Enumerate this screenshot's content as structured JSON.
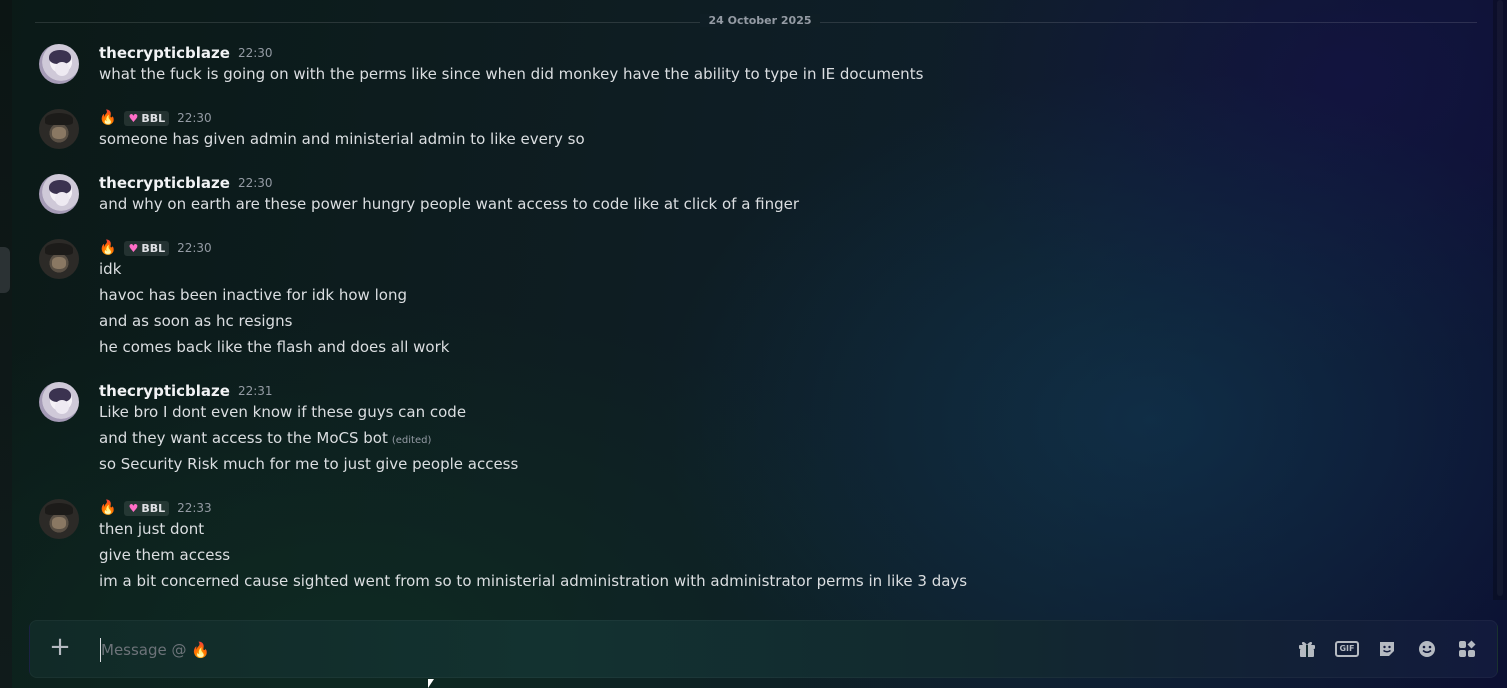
{
  "date_divider": "24 October 2025",
  "messages": [
    {
      "user": "thecrypticblaze",
      "time": "22:30",
      "lines": [
        "what the fuck is going on with the perms like since when did monkey have the ability to type in IE documents"
      ]
    },
    {
      "user": "",
      "tag": "BBL",
      "time": "22:30",
      "lines": [
        "someone has given admin and ministerial admin to like every so"
      ]
    },
    {
      "user": "thecrypticblaze",
      "time": "22:30",
      "lines": [
        "and why on earth are these power hungry people want access to code like at click of a finger"
      ]
    },
    {
      "user": "",
      "tag": "BBL",
      "time": "22:30",
      "lines": [
        "idk",
        "havoc has been inactive for idk how long",
        "and as soon as hc resigns",
        "he comes back like the flash and does all work"
      ]
    },
    {
      "user": "thecrypticblaze",
      "time": "22:31",
      "lines": [
        "Like bro I dont even know if these guys can code",
        "and they want access to the MoCS bot",
        "so Security Risk much for me to just give people access"
      ],
      "edited_label": "(edited)"
    },
    {
      "user": "",
      "tag": "BBL",
      "time": "22:33",
      "lines": [
        "then just dont",
        "give them access",
        "im a bit concerned cause sighted went from so to ministerial administration with administrator perms in like 3 days"
      ]
    }
  ],
  "composer": {
    "placeholder": "Message @ 🔥",
    "icons": [
      "gift-icon",
      "gif-icon",
      "sticker-icon",
      "emoji-icon",
      "apps-icon"
    ],
    "gif_label": "GIF"
  },
  "colors": {
    "flame": "#ff7a1a",
    "heart": "#ff6ec7"
  }
}
